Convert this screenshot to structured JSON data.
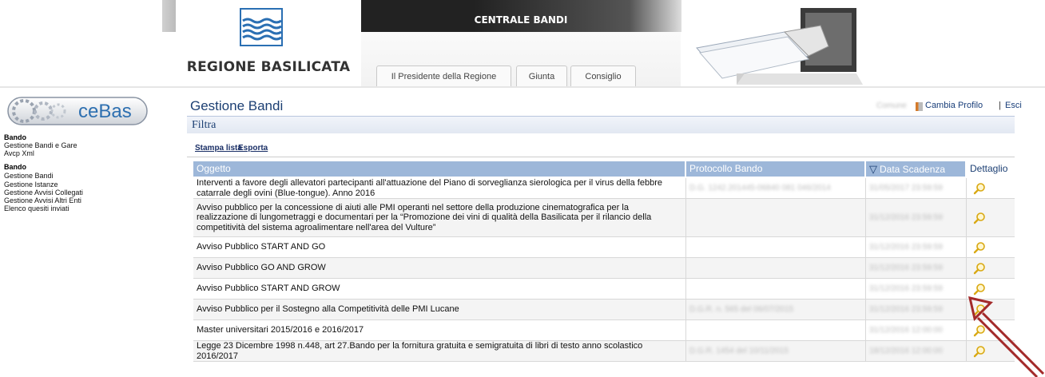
{
  "header": {
    "portal_title": "CENTRALE BANDI",
    "region_name": "REGIONE BASILICATA",
    "tabs": [
      {
        "label": "Il Presidente della Regione"
      },
      {
        "label": "Giunta"
      },
      {
        "label": "Consiglio"
      }
    ]
  },
  "sidebar": {
    "logo_text": "ceBas",
    "sections": [
      {
        "title": "Bando",
        "items": [
          "Gestione Bandi e Gare",
          "Avcp Xml"
        ]
      },
      {
        "title": "Bando",
        "items": [
          "Gestione Bandi",
          "Gestione Istanze",
          "Gestione Avvisi Collegati",
          "Gestione Avvisi Altri Enti",
          "Elenco quesiti inviati"
        ]
      }
    ]
  },
  "topbar": {
    "user_name": "Comune",
    "change_profile": "Cambia Profilo",
    "separator": "|",
    "logout": "Esci"
  },
  "main": {
    "title": "Gestione Bandi",
    "filter_label": "Filtra",
    "actions": {
      "print": "Stampa lista",
      "export": "Esporta"
    },
    "table": {
      "columns": [
        "Oggetto",
        "Protocollo Bando",
        "Data Scadenza",
        "Dettaglio"
      ],
      "sort_indicator": "▽",
      "rows": [
        {
          "oggetto": "Interventi a favore degli allevatori partecipanti all'attuazione del Piano di sorveglianza sierologica per il virus della febbre catarrale degli ovini (Blue-tongue). Anno 2016",
          "protocollo": "D.G. 1242.201445-06840 081 046/2014",
          "scadenza": "31/05/2017 23:59:59"
        },
        {
          "oggetto": "Avviso pubblico per la concessione di aiuti alle PMI operanti nel settore della produzione cinematografica per la realizzazione di lungometraggi e documentari per la “Promozione dei vini di qualità della Basilicata per il rilancio della competitività del sistema agroalimentare nell'area del Vulture”",
          "protocollo": "",
          "scadenza": "31/12/2016 23:59:59"
        },
        {
          "oggetto": "Avviso Pubblico START AND GO",
          "protocollo": "",
          "scadenza": "31/12/2016 23:59:59"
        },
        {
          "oggetto": "Avviso Pubblico GO AND GROW",
          "protocollo": "",
          "scadenza": "31/12/2016 23:59:59"
        },
        {
          "oggetto": "Avviso Pubblico START AND GROW",
          "protocollo": "",
          "scadenza": "31/12/2016 23:59:59"
        },
        {
          "oggetto": "Avviso Pubblico per il Sostegno alla Competitività delle PMI Lucane",
          "protocollo": "D.G.R. n. 565 del 06/07/2015",
          "scadenza": "31/12/2016 23:59:59"
        },
        {
          "oggetto": "Master universitari 2015/2016 e 2016/2017",
          "protocollo": "",
          "scadenza": "31/12/2016 12:00:00"
        },
        {
          "oggetto": "Legge 23 Dicembre 1998 n.448, art 27.Bando per la fornitura gratuita e semigratuita di libri di testo anno scolastico 2016/2017",
          "protocollo": "D.G.R. 1454 del 10/11/2015",
          "scadenza": "18/12/2016 12:00:00"
        }
      ]
    }
  },
  "colors": {
    "table_header": "#9db7d9",
    "title_blue": "#1c3f73",
    "arrow": "#a32a2a"
  }
}
